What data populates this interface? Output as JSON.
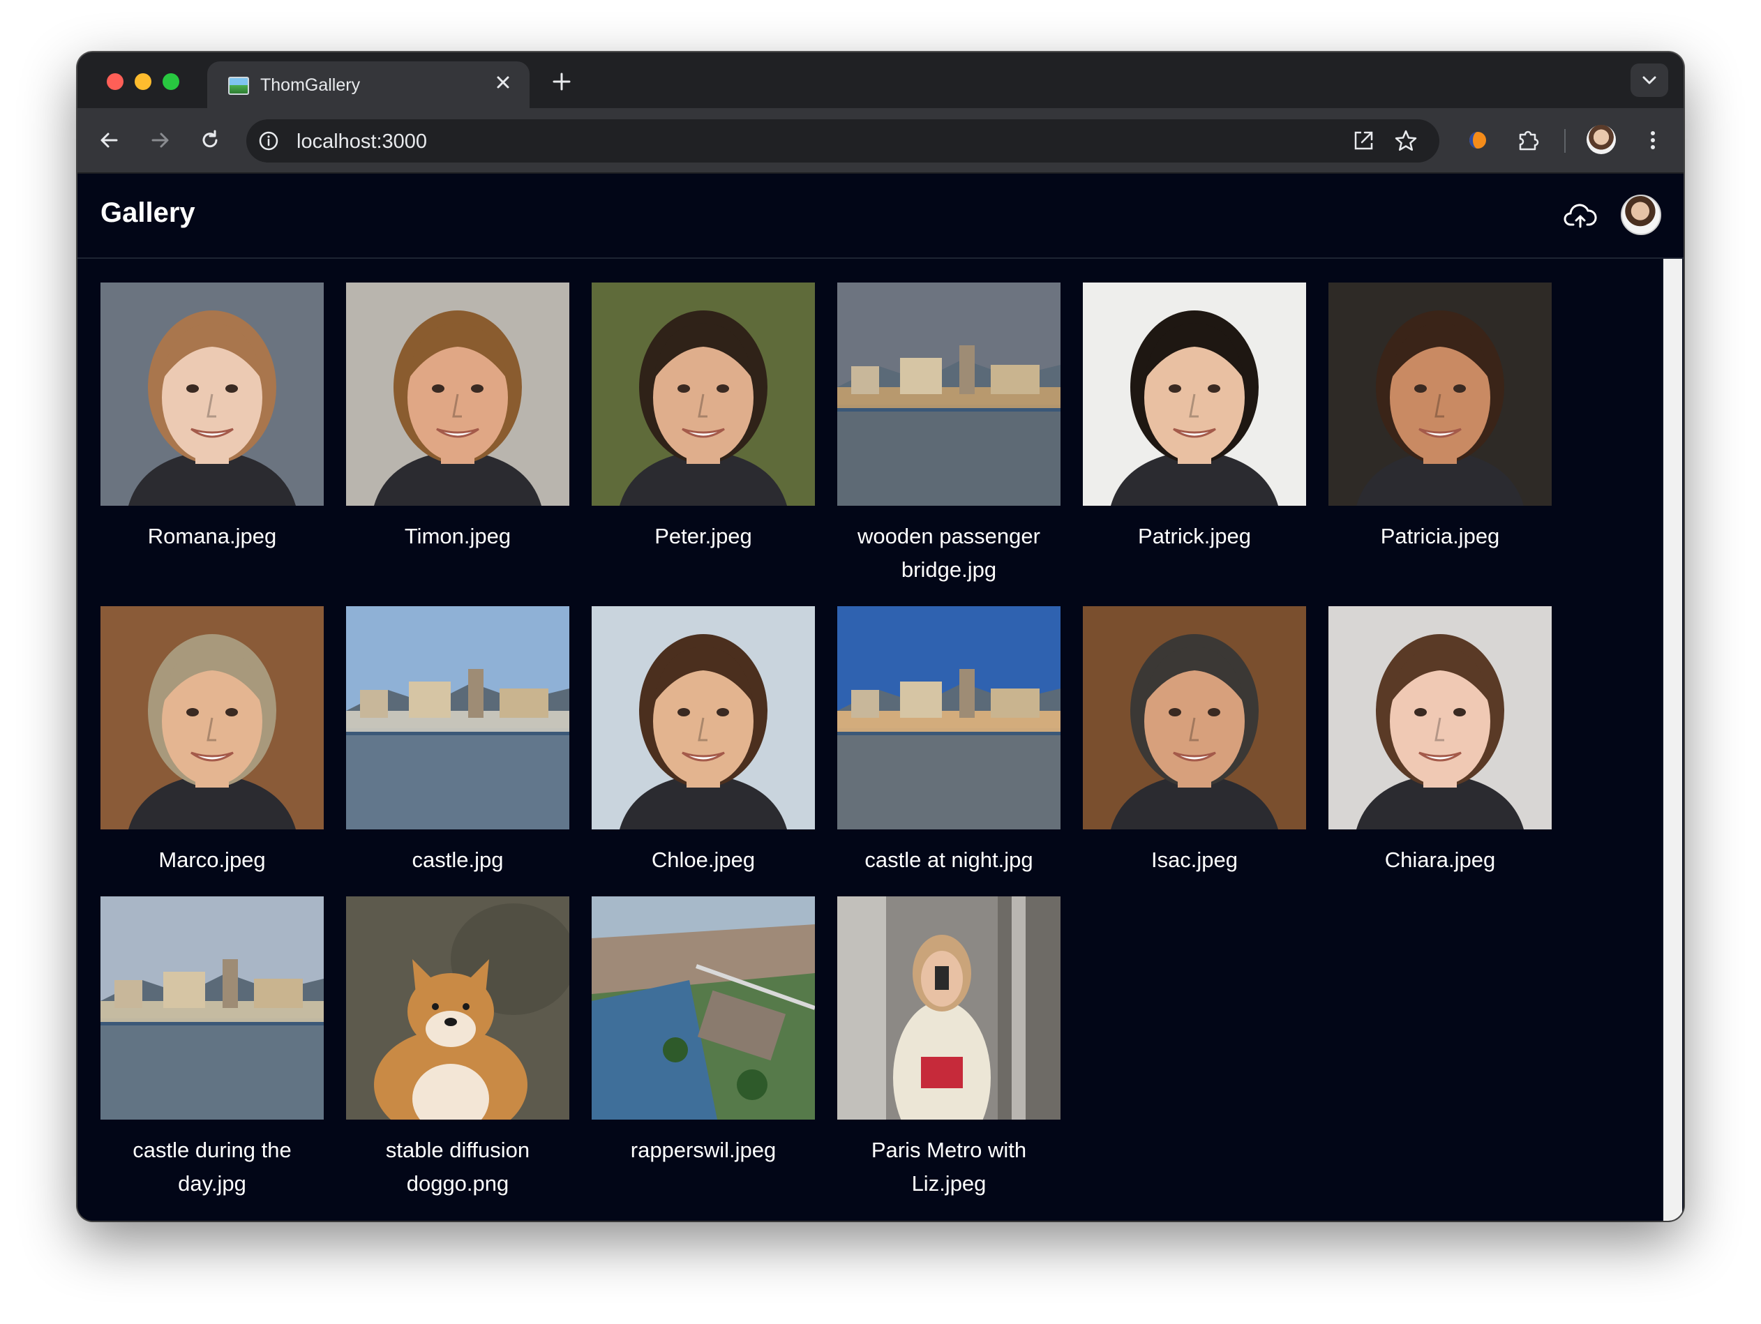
{
  "browser": {
    "tab_title": "ThomGallery",
    "url": "localhost:3000"
  },
  "app": {
    "title": "Gallery"
  },
  "images": [
    {
      "name": "Romana.jpeg",
      "kind": "portrait",
      "bg": "#6b7480",
      "skin": "#eccab3",
      "hair": "#a9764d"
    },
    {
      "name": "Timon.jpeg",
      "kind": "portrait",
      "bg": "#b9b5ae",
      "skin": "#e0a785",
      "hair": "#8a5c2f"
    },
    {
      "name": "Peter.jpeg",
      "kind": "portrait",
      "bg": "#5f6b3a",
      "skin": "#dfae8c",
      "hair": "#2f2218"
    },
    {
      "name": "wooden passenger bridge.jpg",
      "kind": "landscape",
      "bg": "#6d7480",
      "accent": "#c9a16c"
    },
    {
      "name": "Patrick.jpeg",
      "kind": "portrait",
      "bg": "#eeeeec",
      "skin": "#e9c0a2",
      "hair": "#1e1712"
    },
    {
      "name": "Patricia.jpeg",
      "kind": "portrait",
      "bg": "#2e2a26",
      "skin": "#c98a63",
      "hair": "#3a2418"
    },
    {
      "name": "Marco.jpeg",
      "kind": "portrait",
      "bg": "#8a5b38",
      "skin": "#e4b591",
      "hair": "#a8997c"
    },
    {
      "name": "castle.jpg",
      "kind": "landscape",
      "bg": "#8fb1d6",
      "accent": "#d9d3c6"
    },
    {
      "name": "Chloe.jpeg",
      "kind": "portrait",
      "bg": "#c9d4dd",
      "skin": "#e3b48f",
      "hair": "#4b2f1e"
    },
    {
      "name": "castle at night.jpg",
      "kind": "landscape",
      "bg": "#2f62b0",
      "accent": "#e9b77c"
    },
    {
      "name": "Isac.jpeg",
      "kind": "portrait",
      "bg": "#7a4f2e",
      "skin": "#d7a07c",
      "hair": "#3b3835"
    },
    {
      "name": "Chiara.jpeg",
      "kind": "portrait",
      "bg": "#d8d6d4",
      "skin": "#f0c9b4",
      "hair": "#5a3a26"
    },
    {
      "name": "castle during the day.jpg",
      "kind": "landscape",
      "bg": "#a9b6c6",
      "accent": "#d8c9a8"
    },
    {
      "name": "stable diffusion doggo.png",
      "kind": "dog",
      "bg": "#5d5a4d",
      "accent": "#c98a45"
    },
    {
      "name": "rapperswil.jpeg",
      "kind": "aerial",
      "bg": "#567a4a",
      "accent": "#9f8a78"
    },
    {
      "name": "Paris Metro with Liz.jpeg",
      "kind": "metro",
      "bg": "#8c8985",
      "accent": "#c62a3a"
    }
  ],
  "icons": {
    "upload": "cloud-upload-icon",
    "avatar": "avatar"
  }
}
